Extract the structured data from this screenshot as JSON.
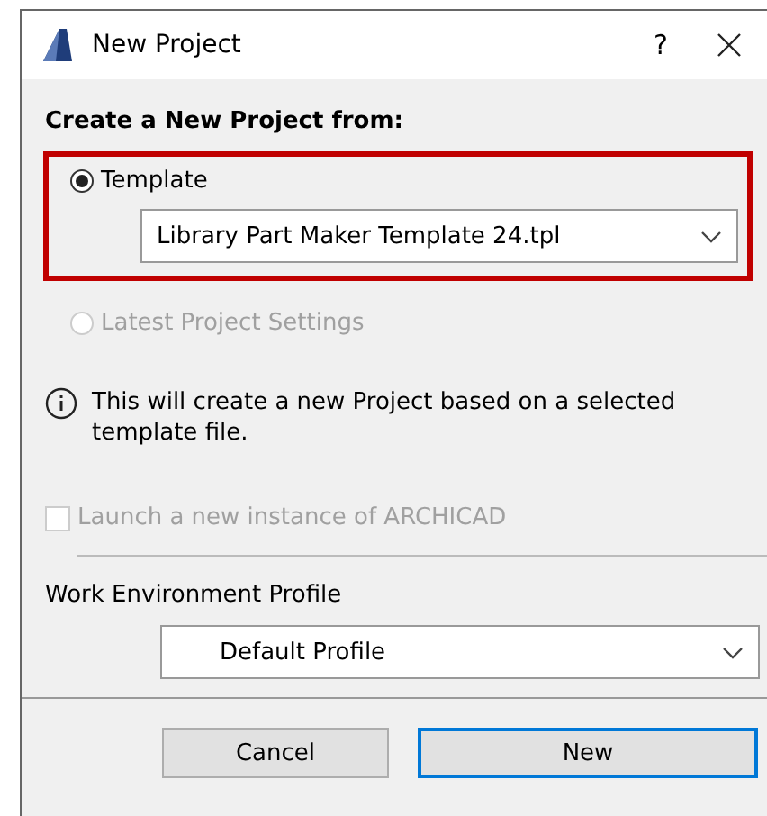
{
  "window": {
    "title": "New Project",
    "help": "?"
  },
  "source": {
    "heading": "Create a New Project from:",
    "options": [
      {
        "label": "Template",
        "selected": true,
        "disabled": false,
        "highlighted": true,
        "dropdown": "Library Part Maker Template 24.tpl"
      },
      {
        "label": "Latest Project Settings",
        "selected": false,
        "disabled": true,
        "highlighted": false
      }
    ]
  },
  "info": "This will create a new Project based on a selected template file.",
  "launch": {
    "label": "Launch a new instance of ARCHICAD",
    "checked": false,
    "disabled": true
  },
  "profile": {
    "label": "Work Environment Profile",
    "value": "Default Profile"
  },
  "buttons": [
    {
      "label": "Cancel",
      "default": false
    },
    {
      "label": "New",
      "default": true
    }
  ]
}
